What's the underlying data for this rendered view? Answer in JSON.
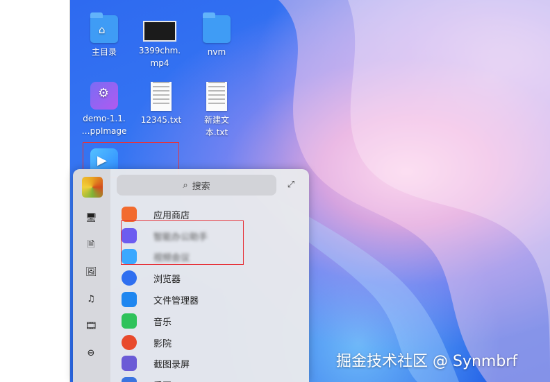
{
  "desktop": {
    "icons": [
      {
        "label": "主目录",
        "kind": "home-folder"
      },
      {
        "label": "3399chm.\nmp4",
        "kind": "video-file"
      },
      {
        "label": "nvm",
        "kind": "folder"
      },
      {
        "label": "demo-1.1.\n…ppImage",
        "kind": "appimage"
      },
      {
        "label": "12345.txt",
        "kind": "text-file"
      },
      {
        "label": "新建文\n本.txt",
        "kind": "text-file"
      },
      {
        "label": "",
        "kind": "camera-app"
      }
    ]
  },
  "launcher": {
    "search_placeholder": "搜索",
    "categories": [
      "monitor-icon",
      "document-icon",
      "image-icon",
      "music-icon",
      "film-icon",
      "circle-menu-icon"
    ],
    "apps": [
      {
        "label": "应用商店",
        "color": "#f26b2e",
        "blurred": false
      },
      {
        "label": "智能办公助手",
        "color": "#6c5cf0",
        "blurred": true
      },
      {
        "label": "视频会议",
        "color": "#3aa8ff",
        "blurred": true
      },
      {
        "label": "浏览器",
        "color": "#2f6ff0",
        "blurred": false
      },
      {
        "label": "文件管理器",
        "color": "#1e86f0",
        "blurred": false
      },
      {
        "label": "音乐",
        "color": "#2fc25b",
        "blurred": false
      },
      {
        "label": "影院",
        "color": "#e84a2c",
        "blurred": false
      },
      {
        "label": "截图录屏",
        "color": "#6b5bd6",
        "blurred": false
      },
      {
        "label": "看图",
        "color": "#3b74e0",
        "blurred": false
      }
    ]
  },
  "watermark": "掘金技术社区 @ Synmbrf",
  "colors": {
    "highlight": "#e6333a",
    "desktop_blue": "#2e6af0"
  }
}
